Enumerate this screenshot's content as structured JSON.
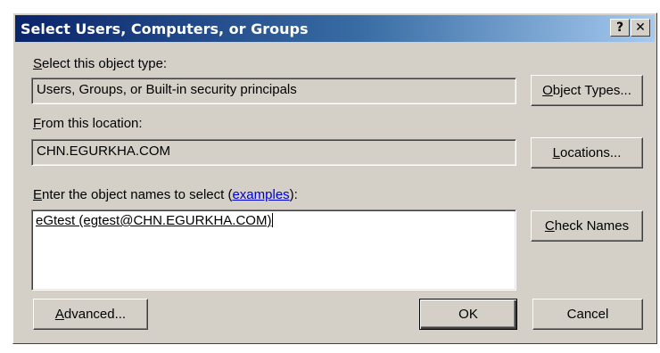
{
  "dialog": {
    "title": "Select Users, Computers, or Groups",
    "help_button": "?",
    "close_button": "✕"
  },
  "object_type": {
    "label_accel": "S",
    "label_rest": "elect this object type:",
    "value": "Users, Groups, or Built-in security principals",
    "button_accel": "O",
    "button_rest": "bject Types..."
  },
  "location": {
    "label_accel": "F",
    "label_rest": "rom this location:",
    "value": "CHN.EGURKHA.COM",
    "button_accel": "L",
    "button_rest": "ocations..."
  },
  "names": {
    "label_accel": "E",
    "label_rest": "nter the object names to select (",
    "label_link": "examples",
    "label_end": "):",
    "value": "eGtest (egtest@CHN.EGURKHA.COM)",
    "check_button_accel": "C",
    "check_button_rest": "heck Names"
  },
  "footer": {
    "advanced_accel": "A",
    "advanced_rest": "dvanced...",
    "ok_label": "OK",
    "cancel_label": "Cancel"
  },
  "colors": {
    "dialog_face": "#d4d0c8",
    "title_start": "#0a246a",
    "title_end": "#a6caf0",
    "link": "#0000cc"
  }
}
